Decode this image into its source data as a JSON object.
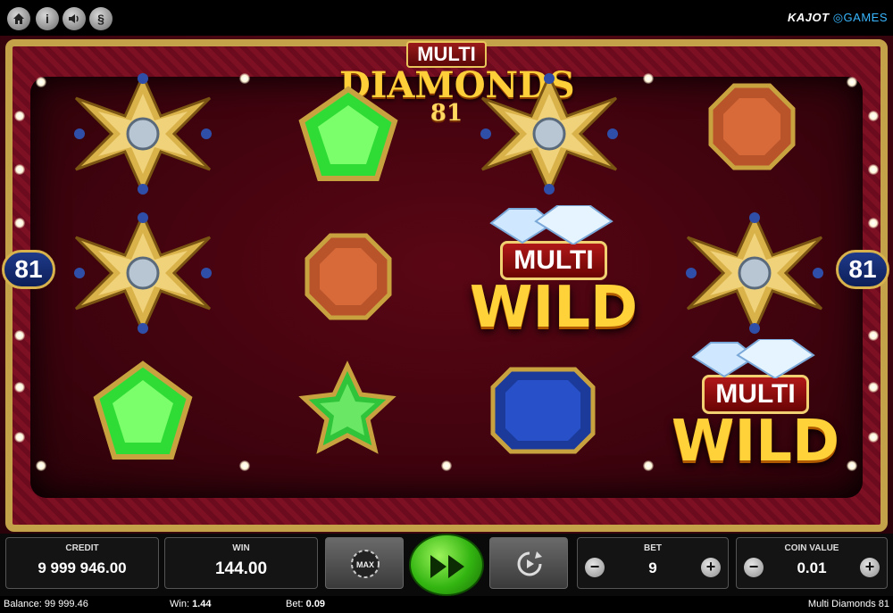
{
  "topbar": {
    "buttons": [
      {
        "name": "home-icon"
      },
      {
        "name": "info-icon",
        "glyph": "i"
      },
      {
        "name": "sound-icon"
      },
      {
        "name": "rules-icon",
        "glyph": "§"
      }
    ],
    "brand_left": "KAJOT",
    "brand_right": "GAMES"
  },
  "logo": {
    "line1": "MULTI",
    "line2": "DIAMONDS",
    "line3": "81"
  },
  "side_badges": {
    "left": "81",
    "right": "81"
  },
  "reels": [
    [
      "gold-star",
      "gold-star",
      "green-pentagon"
    ],
    [
      "green-pentagon",
      "orange-octagon",
      "green-star"
    ],
    [
      "gold-star",
      "multi-wild",
      "blue-octagon"
    ],
    [
      "orange-octagon",
      "gold-star",
      "multi-wild"
    ]
  ],
  "wild": {
    "top": "MULTI",
    "bottom": "WILD"
  },
  "panel": {
    "credit_label": "CREDIT",
    "credit_value": "9 999 946.00",
    "win_label": "WIN",
    "win_value": "144.00",
    "max_label": "MAX",
    "bet_label": "BET",
    "bet_value": "9",
    "coin_label": "COIN VALUE",
    "coin_value": "0.01",
    "minus": "−",
    "plus": "+"
  },
  "status": {
    "balance_label": "Balance:",
    "balance_value": "99 999.46",
    "win_label": "Win:",
    "win_value": "1.44",
    "bet_label": "Bet:",
    "bet_value": "0.09",
    "game_name": "Multi Diamonds 81"
  },
  "colors": {
    "accent_gold": "#c4a24a",
    "spin_green": "#33b511",
    "bg_red": "#4a0612"
  }
}
